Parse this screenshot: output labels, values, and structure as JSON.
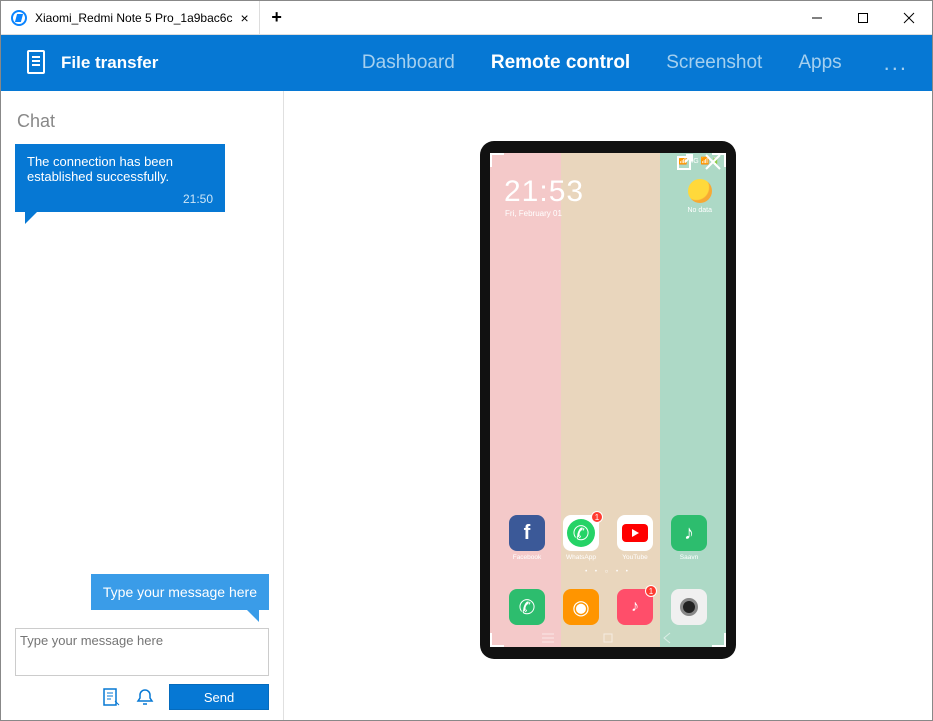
{
  "tab": {
    "title": "Xiaomi_Redmi Note 5 Pro_1a9bac6c"
  },
  "toolbar": {
    "file_transfer": "File transfer"
  },
  "nav": {
    "dashboard": "Dashboard",
    "remote": "Remote control",
    "screenshot": "Screenshot",
    "apps": "Apps",
    "more": "..."
  },
  "chat": {
    "title": "Chat",
    "msg": "The connection has been established successfully.",
    "time": "21:50",
    "placeholder": "Type your message here",
    "send": "Send"
  },
  "phone": {
    "clock": "21:53",
    "date": "Fri, February 01",
    "weather": "No data",
    "status": "📶 4G 📶 🔋",
    "apps_row": [
      {
        "label": "Facebook",
        "badge": null
      },
      {
        "label": "WhatsApp",
        "badge": "1"
      },
      {
        "label": "YouTube",
        "badge": null
      },
      {
        "label": "Saavn",
        "badge": null
      }
    ],
    "dock_badges": [
      null,
      null,
      "1",
      null
    ]
  }
}
